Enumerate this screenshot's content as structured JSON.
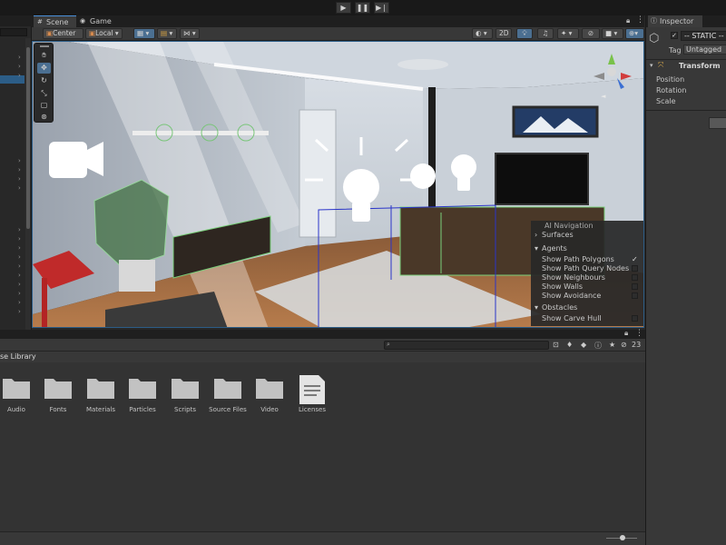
{
  "toolbar": {
    "play_icon": "play-icon",
    "pause_icon": "pause-icon",
    "step_icon": "step-icon"
  },
  "scene_tabs": [
    {
      "label": "Scene"
    },
    {
      "label": "Game"
    }
  ],
  "scene_toolbar": {
    "pivot": "Center",
    "space": "Local",
    "mode_2d": "2D"
  },
  "ai_navigation": {
    "title": "AI Navigation",
    "surfaces": "Surfaces",
    "agents_header": "Agents",
    "agents": [
      "Show Path Polygons",
      "Show Path Query Nodes",
      "Show Neighbours",
      "Show Walls",
      "Show Avoidance"
    ],
    "obstacles_header": "Obstacles",
    "obstacles": [
      "Show Carve Hull"
    ]
  },
  "inspector": {
    "tab": "Inspector",
    "object_name": "-- STATIC --",
    "tag_label": "Tag",
    "tag_value": "Untagged",
    "component": "Transform",
    "fields": [
      "Position",
      "Rotation",
      "Scale"
    ]
  },
  "project": {
    "breadcrumb": "se Library",
    "hidden_count": "23",
    "folders": [
      "Audio",
      "Fonts",
      "Materials",
      "Particles",
      "Scripts",
      "Source Files",
      "Video"
    ],
    "files": [
      "Licenses"
    ]
  },
  "colors": {
    "accent": "#4b6f91",
    "selection": "#2c5d87",
    "panel": "#383838"
  }
}
